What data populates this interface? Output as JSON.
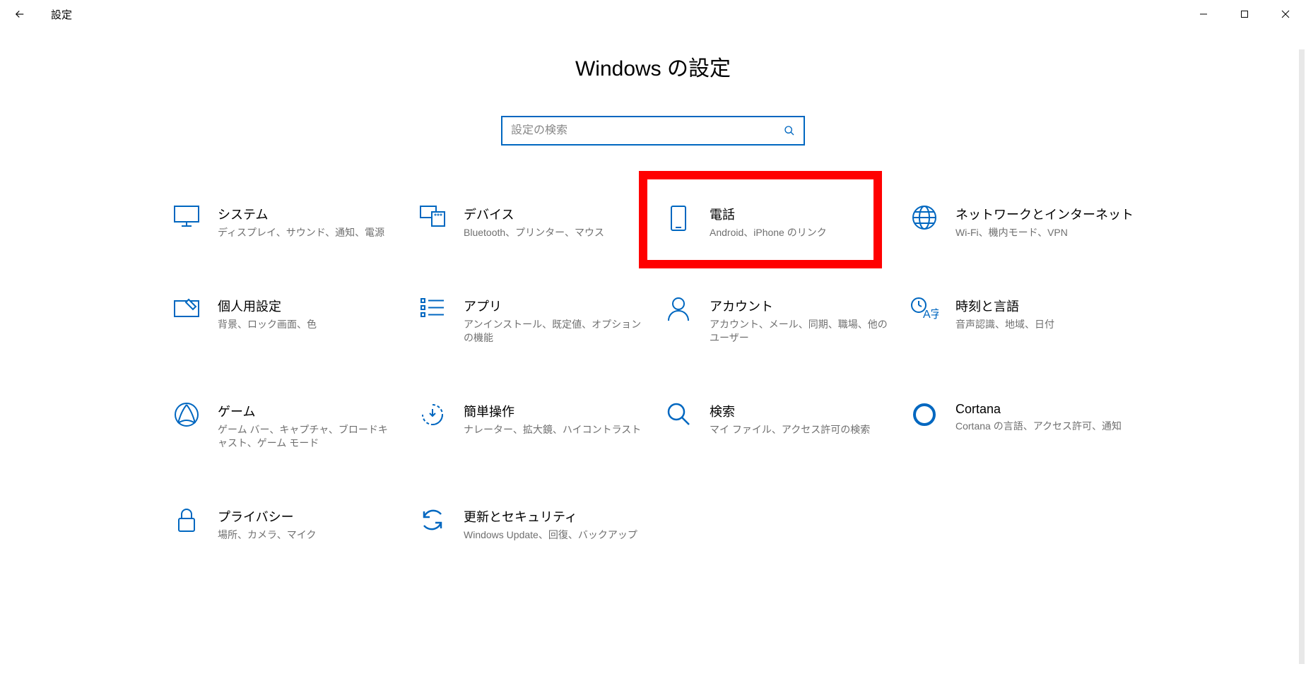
{
  "titlebar": {
    "app_title": "設定"
  },
  "page": {
    "title": "Windows の設定",
    "search_placeholder": "設定の検索"
  },
  "tiles": [
    {
      "title": "システム",
      "sub": "ディスプレイ、サウンド、通知、電源"
    },
    {
      "title": "デバイス",
      "sub": "Bluetooth、プリンター、マウス"
    },
    {
      "title": "電話",
      "sub": "Android、iPhone のリンク"
    },
    {
      "title": "ネットワークとインターネット",
      "sub": "Wi-Fi、機内モード、VPN"
    },
    {
      "title": "個人用設定",
      "sub": "背景、ロック画面、色"
    },
    {
      "title": "アプリ",
      "sub": "アンインストール、既定値、オプションの機能"
    },
    {
      "title": "アカウント",
      "sub": "アカウント、メール、同期、職場、他のユーザー"
    },
    {
      "title": "時刻と言語",
      "sub": "音声認識、地域、日付"
    },
    {
      "title": "ゲーム",
      "sub": "ゲーム バー、キャプチャ、ブロードキャスト、ゲーム モード"
    },
    {
      "title": "簡単操作",
      "sub": "ナレーター、拡大鏡、ハイコントラスト"
    },
    {
      "title": "検索",
      "sub": "マイ ファイル、アクセス許可の検索"
    },
    {
      "title": "Cortana",
      "sub": "Cortana の言語、アクセス許可、通知"
    },
    {
      "title": "プライバシー",
      "sub": "場所、カメラ、マイク"
    },
    {
      "title": "更新とセキュリティ",
      "sub": "Windows Update、回復、バックアップ"
    }
  ],
  "highlight": {
    "index": 2
  }
}
